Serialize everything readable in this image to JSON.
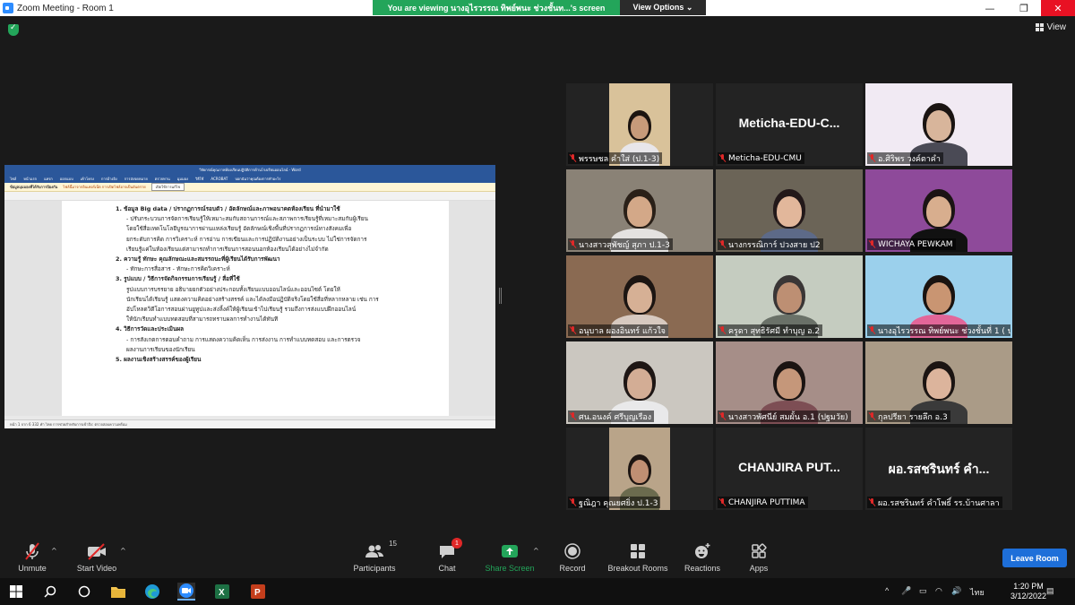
{
  "window": {
    "title": "Zoom Meeting - Room 1",
    "minimize": "—",
    "maximize": "❐",
    "close": "✕"
  },
  "share_banner": {
    "text": "You are viewing นางอุไรวรรณ ทิพย์พนะ ช่วงชั้นท...'s screen",
    "view_options": "View Options ⌄"
  },
  "view_button": "View",
  "document": {
    "title": "วิจัยกรณ์คุณภาพห้องเรียนปฏิบัติการด้านโรงเรียนออนไลน์ - Word",
    "ribbon": [
      "ไฟล์",
      "หน้าแรก",
      "แทรก",
      "ออกแบบ",
      "เค้าโครง",
      "การอ้างอิง",
      "การส่งจดหมาย",
      "ตรวจทาน",
      "มุมมอง",
      "วิธีใช้",
      "ACROBAT",
      "บอกฉันว่าคุณต้องการทำอะไร"
    ],
    "msgbar": [
      "ข้อมูลมุมมองที่ได้รับการป้องกัน",
      "ไฟล์นี้มาจากอินเทอร์เน็ต การเปิดไฟล์อาจเป็นอันตราย",
      "เปิดใช้การแก้ไข"
    ],
    "status": "หน้า 1 จาก 6   332 คำ   ไทย   การช่วยสำหรับการเข้าถึง: ตรวจสอบความพร้อม",
    "lines": [
      {
        "t": "1.  ข้อมูล Big data / ปรากฏการณ์รอบตัว / อัตลักษณ์และภาพอนาคตห้องเรียน ที่นำมาใช้",
        "s": "h"
      },
      {
        "t": "-   ปรับกระบวนการจัดการเรียนรู้ให้เหมาะสมกับสถานการณ์และสภาพการเรียนรู้ที่เหมาะสมกับผู้เรียน",
        "s": "i"
      },
      {
        "t": "โดยใช้สื่อเทคโนโลยีบูรณาการผ่านแหล่งเรียนรู้ อัตลักษณ์เชิงพื้นที่ปรากฏการณ์ทางสังคมเพื่อ",
        "s": "i"
      },
      {
        "t": "ยกระดับการคิด การวิเคราะห์ การอ่าน การเขียนและการปฏิบัติงานอย่างเป็นระบบ ไม่ใช่การจัดการ",
        "s": "i"
      },
      {
        "t": "เรียนรู้แค่ในห้องเรียนแต่สามารถทำการเรียนการสอนนอกห้องเรียนได้อย่างไม่จำกัด",
        "s": "i"
      },
      {
        "t": "2.  ความรู้ ทักษะ คุณลักษณะและสมรรถนะที่ผู้เรียนได้รับการพัฒนา",
        "s": "h"
      },
      {
        "t": "-   ทักษะการสื่อสาร                          -  ทักษะการคิดวิเคราะห์",
        "s": "i"
      },
      {
        "t": "3.  รูปแบบ / วิธีการจัดกิจกรรมการเรียนรู้ / สื่อที่ใช้",
        "s": "h"
      },
      {
        "t": "รูปแบบการบรรยาย อธิบายยกตัวอย่างประกอบทั้งเรียนแบบออนไลน์และออนไซต์ โดยให้",
        "s": "i"
      },
      {
        "t": "นักเรียนได้เรียนรู้ แสดงความคิดอย่างสร้างสรรค์ และได้ลงมือปฏิบัติจริงโดยใช้สื่อที่หลากหลาย เช่น การ",
        "s": "i"
      },
      {
        "t": "อัปโหลดวิดีโอการสอนผ่านยูทูปและส่งลิ้งค์ให้ผู้เรียนเข้าไปเรียนรู้ รวมถึงการส่งแบบฝึกออนไลน์",
        "s": "i"
      },
      {
        "t": "ให้นักเรียนทำแบบทดสอบที่สามารถทราบผลการทำงานได้ทันที",
        "s": "i"
      },
      {
        "t": "4.  วิธีการวัดและประเมินผล",
        "s": "h"
      },
      {
        "t": "-   การสังเกตการตอบคำถาม การแสดงความคิดเห็น การส่งงาน การทำแบบทดสอบ และการตรวจ",
        "s": "i"
      },
      {
        "t": "ผลงานการเรียนของนักเรียน",
        "s": "i"
      },
      {
        "t": "5.  ผลงานเชิงสร้างสรรค์ของผู้เรียน",
        "s": "h"
      }
    ]
  },
  "participants": [
    {
      "name": "พรรษชล คำใส่ (ป.1-3)",
      "big": "",
      "bg": "#3a3a3a",
      "face": "#c79a7a",
      "hair": "#1c1410",
      "shirt": "#e8e6ea",
      "room": "#d9c29a"
    },
    {
      "name": "Meticha-EDU-CMU",
      "big": "Meticha-EDU-C...",
      "bg": "#232323"
    },
    {
      "name": "อ.ศิริพร วงค์ตาคำ",
      "big": "",
      "bg": "#efeaf4",
      "face": "#d8b59b",
      "hair": "#1a1412",
      "shirt": "#4a4a55",
      "room": "#f1eaf3"
    },
    {
      "name": "นางสาวสุพัชญ์ สุภา ป.1-3",
      "big": "",
      "bg": "#5e5a52",
      "face": "#d3a888",
      "hair": "#2a2018",
      "shirt": "#e4e2e0",
      "room": "#8a8276"
    },
    {
      "name": "นางกรรณิการ์ ปวงสาย ป2",
      "big": "",
      "bg": "#2a2a2a",
      "face": "#e2b79b",
      "hair": "#23191a",
      "shirt": "#5d6a88",
      "room": "#6b6457"
    },
    {
      "name": "WICHAYA PEWKAM",
      "big": "",
      "bg": "#7c3a8a",
      "face": "#d8ae8e",
      "hair": "#1b1414",
      "shirt": "#111111",
      "room": "#8e4a9a"
    },
    {
      "name": "อนุบาล ผองอินทร์ แก้วใจ",
      "big": "",
      "bg": "#7b5a44",
      "face": "#d6b095",
      "hair": "#1c1512",
      "shirt": "#d7c9c0",
      "room": "#8a6a52"
    },
    {
      "name": "ครูดา สุทธิรัศมี ทำบุญ อ.2",
      "big": "",
      "bg": "#a9b3a2",
      "face": "#bd8f73",
      "hair": "#3a3636",
      "shirt": "#6a7168",
      "room": "#c5ccc0"
    },
    {
      "name": "นางอุไรวรรณ ทิพย์พนะ ช่วงชั้นที่ 1 ( ป. 1...",
      "big": "",
      "bg": "#7fc2e4",
      "face": "#c99572",
      "hair": "#1a1310",
      "shirt": "#e26699",
      "room": "#9bd0ec"
    },
    {
      "name": "ศน.อนงค์ ศรีบุญเรือง",
      "big": "",
      "bg": "#b9b4ac",
      "face": "#d3ad95",
      "hair": "#1e1614",
      "shirt": "#e9e9ea",
      "room": "#cbc7c0"
    },
    {
      "name": "นางสาวพัศนีย์ สมผั้น อ.1 (ปฐมวัย)",
      "big": "",
      "bg": "#8c6c66",
      "face": "#c5977a",
      "hair": "#1b1412",
      "shirt": "#7d4e54",
      "room": "#a68e88"
    },
    {
      "name": "กุลปรียา รายลึก อ.3",
      "big": "",
      "bg": "#8f8371",
      "face": "#dcb49c",
      "hair": "#1b1412",
      "shirt": "#3a3a3a",
      "room": "#aa9b87"
    },
    {
      "name": "ฐณิฎา คุณยศยิ่ง ป.1-3",
      "big": "",
      "bg": "#232323",
      "face": "#c08f73",
      "hair": "#1d1512",
      "shirt": "#6b6b4e",
      "room": "#b9a489"
    },
    {
      "name": "CHANJIRA PUTTIMA",
      "big": "CHANJIRA PUT...",
      "bg": "#232323"
    },
    {
      "name": "ผอ.รสชรินทร์ คำโพธิ์ รร.บ้านศาลา",
      "big": "ผอ.รสชรินทร์ คำ...",
      "bg": "#232323"
    }
  ],
  "active_speaker_index": 8,
  "toolbar": {
    "unmute": "Unmute",
    "start_video": "Start Video",
    "participants": "Participants",
    "participants_count": "15",
    "chat": "Chat",
    "chat_badge": "1",
    "share_screen": "Share Screen",
    "record": "Record",
    "breakout_rooms": "Breakout Rooms",
    "reactions": "Reactions",
    "apps": "Apps",
    "leave": "Leave Room"
  },
  "colors": {
    "share_green": "#23a55a",
    "leave_blue": "#1e6fd9",
    "mic_red": "#e02828",
    "active_outline": "#e2e52a"
  },
  "taskbar": {
    "apps": [
      "windows-start-icon",
      "search-icon",
      "task-view-icon",
      "file-explorer-icon",
      "edge-icon",
      "zoom-icon",
      "excel-icon",
      "powerpoint-icon"
    ],
    "language": "ไทย",
    "time": "1:20 PM",
    "date": "3/12/2022"
  }
}
